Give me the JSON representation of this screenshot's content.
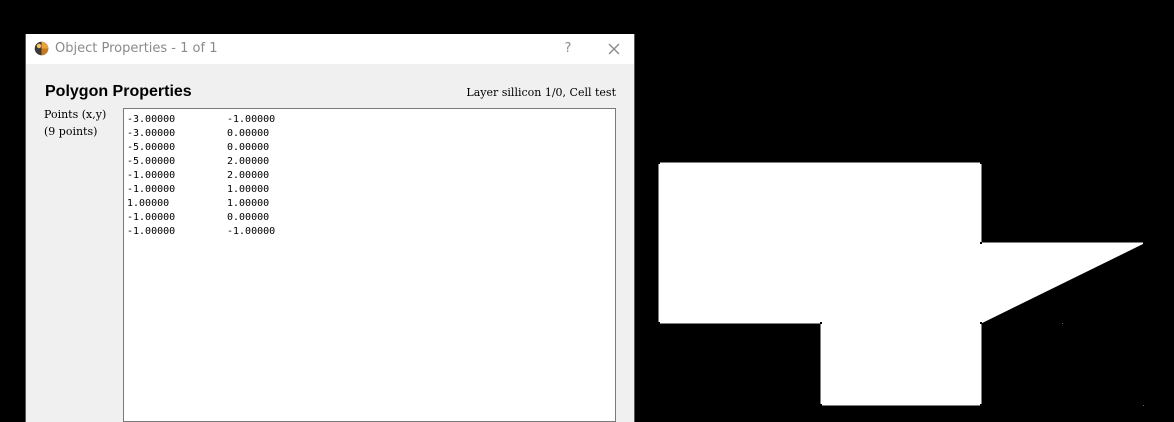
{
  "window": {
    "title": "Object Properties - 1 of 1",
    "help_label": "?",
    "app_icon": "klayout-logo-icon",
    "close_icon": "close-icon"
  },
  "header": {
    "title": "Polygon Properties",
    "layer_info": "Layer sillicon 1/0, Cell test"
  },
  "points": {
    "label": "Points (x,y)",
    "count_label": "(9 points)",
    "list": [
      {
        "x": "-3.00000",
        "y": "-1.00000"
      },
      {
        "x": "-3.00000",
        "y": "0.00000"
      },
      {
        "x": "-5.00000",
        "y": "0.00000"
      },
      {
        "x": "-5.00000",
        "y": "2.00000"
      },
      {
        "x": "-1.00000",
        "y": "2.00000"
      },
      {
        "x": "-1.00000",
        "y": "1.00000"
      },
      {
        "x": "1.00000",
        "y": "1.00000"
      },
      {
        "x": "-1.00000",
        "y": "0.00000"
      },
      {
        "x": "-1.00000",
        "y": "-1.00000"
      }
    ]
  },
  "colors": {
    "canvas_background": "#000000",
    "polygon_fill": "#ffffff",
    "dialog_background": "#f0f0f0",
    "title_text": "#8a8a8a"
  }
}
